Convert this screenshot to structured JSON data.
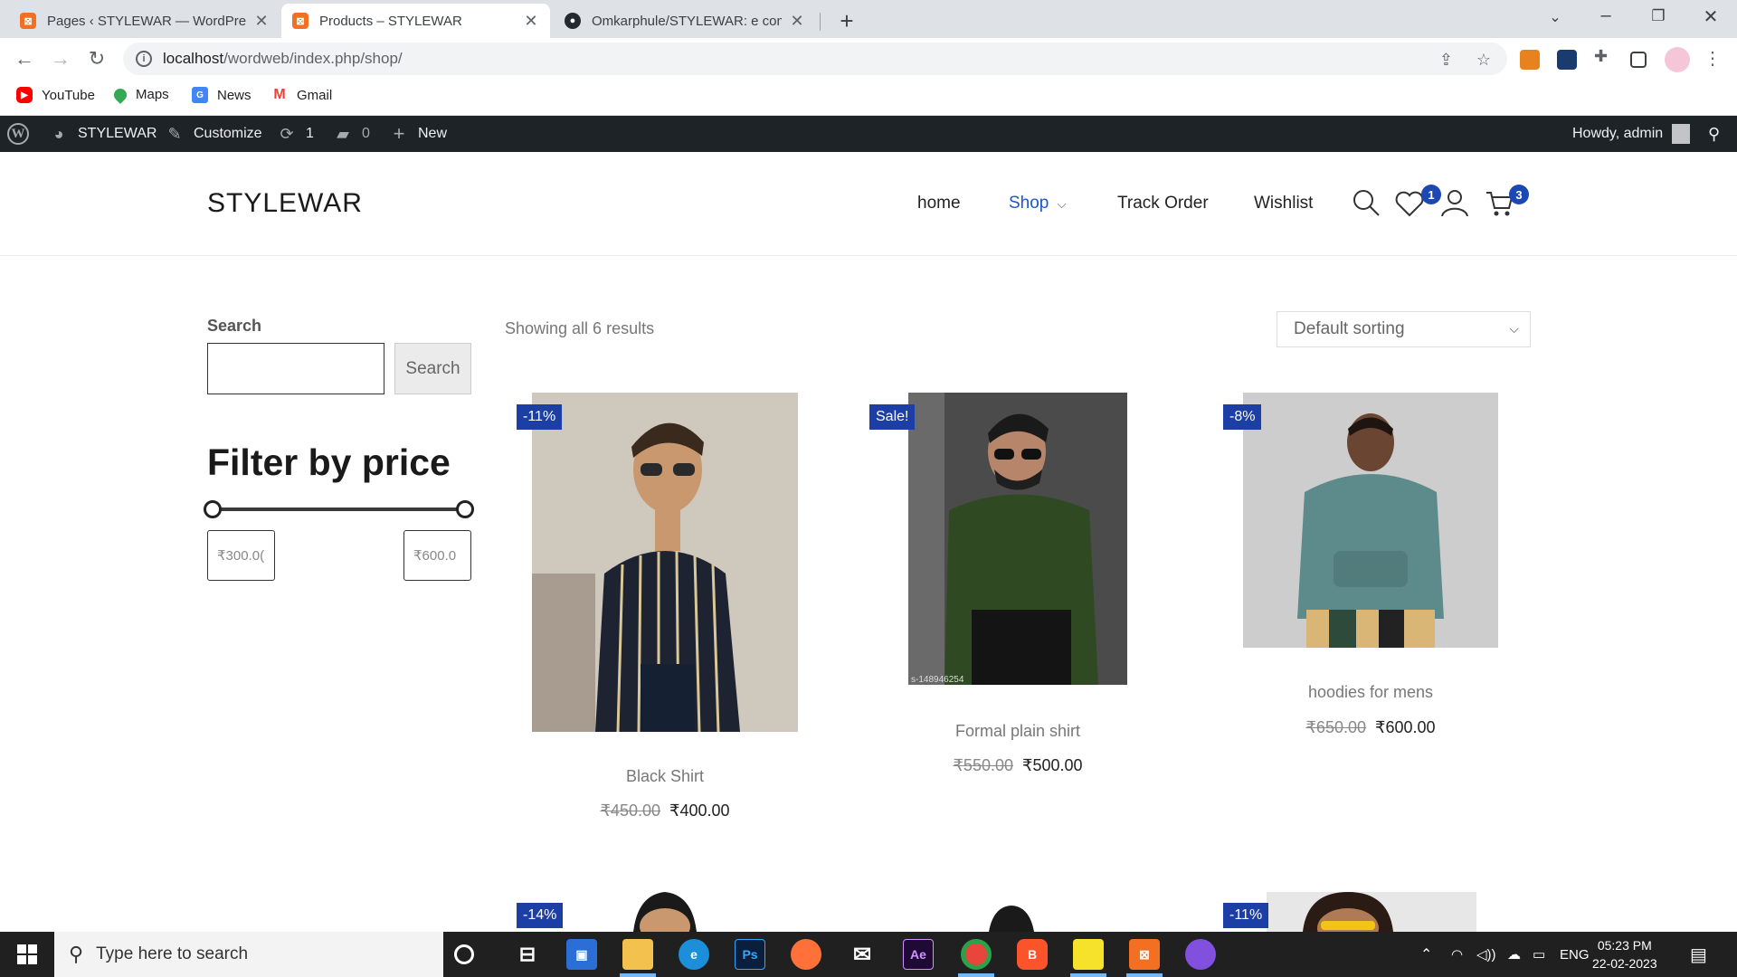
{
  "browser": {
    "tabs": [
      {
        "label": "Pages ‹ STYLEWAR — WordPress",
        "icon": "xampp-icon",
        "active": false
      },
      {
        "label": "Products – STYLEWAR",
        "icon": "xampp-icon",
        "active": true
      },
      {
        "label": "Omkarphule/STYLEWAR: e comm",
        "icon": "github-icon",
        "active": false
      }
    ],
    "url_host": "localhost",
    "url_path": "/wordweb/index.php/shop/",
    "bookmarks": [
      {
        "label": "YouTube",
        "icon": "youtube-icon",
        "color": "#ff0000"
      },
      {
        "label": "Maps",
        "icon": "maps-icon",
        "color": "#34a853"
      },
      {
        "label": "News",
        "icon": "news-icon",
        "color": "#4285f4"
      },
      {
        "label": "Gmail",
        "icon": "gmail-icon",
        "color": "#ea4335"
      }
    ]
  },
  "adminbar": {
    "site_name": "STYLEWAR",
    "customize": "Customize",
    "updates_count": "1",
    "comments_count": "0",
    "new_label": "New",
    "howdy": "Howdy, admin"
  },
  "header": {
    "site_title": "STYLEWAR",
    "nav": [
      {
        "label": "home",
        "current": false
      },
      {
        "label": "Shop",
        "current": true,
        "has_dropdown": true
      },
      {
        "label": "Track Order",
        "current": false
      },
      {
        "label": "Wishlist",
        "current": false
      }
    ],
    "wishlist_count": "1",
    "cart_count": "3",
    "accent": "#1c57c9"
  },
  "sidebar": {
    "search_label": "Search",
    "search_button": "Search",
    "filter_title": "Filter by price",
    "min_price": "₹300.0(",
    "max_price": "₹600.0"
  },
  "shop": {
    "result_count": "Showing all 6 results",
    "sorting": "Default sorting",
    "products": [
      {
        "badge": "-11%",
        "name": "Black Shirt",
        "regular_price": "₹450.00",
        "sale_price": "₹400.00",
        "image_text": ""
      },
      {
        "badge": "Sale!",
        "name": "Formal plain shirt",
        "regular_price": "₹550.00",
        "sale_price": "₹500.00",
        "image_text": "s-148946254"
      },
      {
        "badge": "-8%",
        "name": "hoodies for mens",
        "regular_price": "₹650.00",
        "sale_price": "₹600.00",
        "image_text": ""
      },
      {
        "badge": "-14%"
      },
      {
        "badge": ""
      },
      {
        "badge": "-11%"
      }
    ],
    "badge_color": "#1c3fa6"
  },
  "taskbar": {
    "search_placeholder": "Type here to search",
    "language": "ENG",
    "time": "05:23 PM",
    "date": "22-02-2023"
  }
}
